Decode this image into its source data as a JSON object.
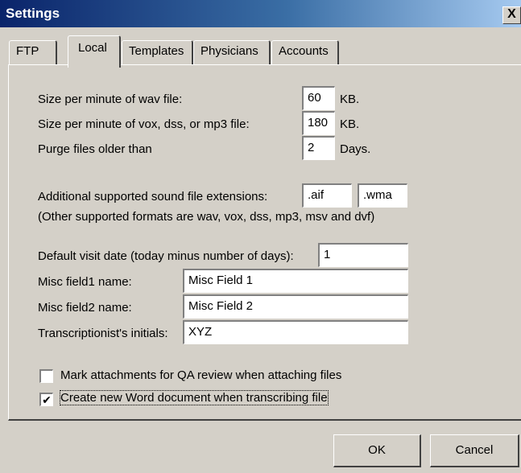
{
  "window": {
    "title": "Settings",
    "close_glyph": "X"
  },
  "tabs": [
    {
      "label": "FTP",
      "active": false
    },
    {
      "label": "Local",
      "active": true
    },
    {
      "label": "Templates",
      "active": false
    },
    {
      "label": "Physicians",
      "active": false
    },
    {
      "label": "Accounts",
      "active": false
    }
  ],
  "file_sizes": {
    "wav_label": "Size per minute of wav file:",
    "wav_value": "60",
    "wav_unit": "KB.",
    "vox_label": "Size per minute of vox, dss, or mp3 file:",
    "vox_value": "180",
    "vox_unit": "KB.",
    "purge_label": "Purge files older than",
    "purge_value": "2",
    "purge_unit": "Days."
  },
  "extensions": {
    "label": "Additional supported sound file extensions:",
    "ext1": ".aif",
    "ext2": ".wma",
    "note": "(Other supported formats are wav, vox, dss, mp3, msv and dvf)"
  },
  "fields": {
    "visit_label": "Default visit date (today minus number of days):",
    "visit_value": "1",
    "misc1_label": "Misc field1 name:",
    "misc1_value": "Misc Field 1",
    "misc2_label": "Misc field2 name:",
    "misc2_value": "Misc Field 2",
    "initials_label": "Transcriptionist's initials:",
    "initials_value": "XYZ"
  },
  "options": {
    "qa_label": "Mark attachments for QA review when attaching files",
    "qa_checked": false,
    "word_label": "Create new Word document when transcribing file",
    "word_checked": true,
    "check_glyph": "✔"
  },
  "buttons": {
    "ok": "OK",
    "cancel": "Cancel"
  }
}
